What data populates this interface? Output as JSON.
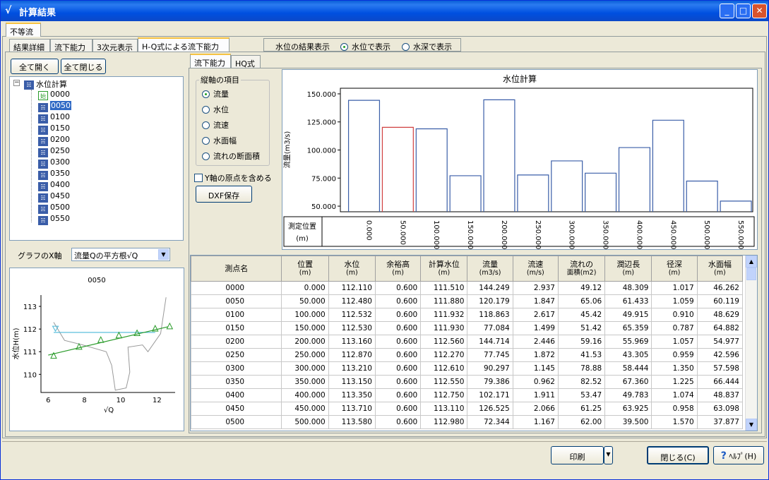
{
  "window": {
    "title": "計算結果"
  },
  "top_tab": "不等流",
  "sub_tabs": [
    "結果詳細",
    "流下能力",
    "3次元表示",
    "H-Q式による流下能力"
  ],
  "result_display": {
    "label": "水位の結果表示",
    "options": [
      "水位で表示",
      "水深で表示"
    ],
    "selected": "水位で表示"
  },
  "tree": {
    "buttons": [
      "全て開く",
      "全て閉じる"
    ],
    "root": "水位計算",
    "items": [
      "0000",
      "0050",
      "0100",
      "0150",
      "0200",
      "0250",
      "0300",
      "0350",
      "0400",
      "0450",
      "0500",
      "0550"
    ],
    "selected": "0050"
  },
  "graph_x": {
    "label": "グラフのX軸",
    "value": "流量Qの平方根√Q"
  },
  "small_chart": {
    "title": "0050",
    "ylabel": "水位H(m)",
    "xlabel": "√Q",
    "y_ticks": [
      "113",
      "112",
      "111",
      "110"
    ],
    "x_ticks": [
      "6",
      "8",
      "10",
      "12"
    ]
  },
  "right_tabs": [
    "流下能力",
    "HQ式"
  ],
  "axis_group": {
    "label": "縦軸の項目",
    "options": [
      "流量",
      "水位",
      "流速",
      "水面幅",
      "流れの断面積"
    ],
    "selected": "流量"
  },
  "y_origin_checkbox": "Y軸の原点を含める",
  "dxf_button": "DXF保存",
  "chart_data": {
    "type": "bar",
    "title": "水位計算",
    "ylabel": "流量(m3/s)",
    "xlabel": "測定位置(m)",
    "y_ticks": [
      "150.000",
      "125.000",
      "100.000",
      "75.000",
      "50.000"
    ],
    "ylim": [
      45,
      155
    ],
    "x_ticks": [
      "0.000",
      "50.000",
      "100.000",
      "150.000",
      "200.000",
      "250.000",
      "300.000",
      "350.000",
      "400.000",
      "450.000",
      "500.000",
      "550.000"
    ],
    "x": [
      0,
      50,
      100,
      150,
      200,
      250,
      300,
      350,
      400,
      450,
      500,
      550
    ],
    "values": [
      144.249,
      120.179,
      118.863,
      77.084,
      144.714,
      77.745,
      90.297,
      79.386,
      102.171,
      126.525,
      72.344,
      54.5
    ],
    "highlight_index": 1,
    "colors": {
      "bar": "#3a5ea8",
      "highlight": "#d04040"
    }
  },
  "table": {
    "headers": [
      [
        "測点名",
        ""
      ],
      [
        "位置",
        "(m)"
      ],
      [
        "水位",
        "(m)"
      ],
      [
        "余裕高",
        "(m)"
      ],
      [
        "計算水位",
        "(m)"
      ],
      [
        "流量",
        "(m3/s)"
      ],
      [
        "流速",
        "(m/s)"
      ],
      [
        "流れの",
        "面積(m2)"
      ],
      [
        "潤辺長",
        "(m)"
      ],
      [
        "径深",
        "(m)"
      ],
      [
        "水面幅",
        "(m)"
      ]
    ],
    "rows": [
      [
        "0000",
        "0.000",
        "112.110",
        "0.600",
        "111.510",
        "144.249",
        "2.937",
        "49.12",
        "48.309",
        "1.017",
        "46.262"
      ],
      [
        "0050",
        "50.000",
        "112.480",
        "0.600",
        "111.880",
        "120.179",
        "1.847",
        "65.06",
        "61.433",
        "1.059",
        "60.119"
      ],
      [
        "0100",
        "100.000",
        "112.532",
        "0.600",
        "111.932",
        "118.863",
        "2.617",
        "45.42",
        "49.915",
        "0.910",
        "48.629"
      ],
      [
        "0150",
        "150.000",
        "112.530",
        "0.600",
        "111.930",
        "77.084",
        "1.499",
        "51.42",
        "65.359",
        "0.787",
        "64.882"
      ],
      [
        "0200",
        "200.000",
        "113.160",
        "0.600",
        "112.560",
        "144.714",
        "2.446",
        "59.16",
        "55.969",
        "1.057",
        "54.977"
      ],
      [
        "0250",
        "250.000",
        "112.870",
        "0.600",
        "112.270",
        "77.745",
        "1.872",
        "41.53",
        "43.305",
        "0.959",
        "42.596"
      ],
      [
        "0300",
        "300.000",
        "113.210",
        "0.600",
        "112.610",
        "90.297",
        "1.145",
        "78.88",
        "58.444",
        "1.350",
        "57.598"
      ],
      [
        "0350",
        "350.000",
        "113.150",
        "0.600",
        "112.550",
        "79.386",
        "0.962",
        "82.52",
        "67.360",
        "1.225",
        "66.444"
      ],
      [
        "0400",
        "400.000",
        "113.350",
        "0.600",
        "112.750",
        "102.171",
        "1.911",
        "53.47",
        "49.783",
        "1.074",
        "48.837"
      ],
      [
        "0450",
        "450.000",
        "113.710",
        "0.600",
        "113.110",
        "126.525",
        "2.066",
        "61.25",
        "63.925",
        "0.958",
        "63.098"
      ],
      [
        "0500",
        "500.000",
        "113.580",
        "0.600",
        "112.980",
        "72.344",
        "1.167",
        "62.00",
        "39.500",
        "1.570",
        "37.877"
      ]
    ]
  },
  "footer": {
    "print": "印刷",
    "close": "閉じる(C)",
    "help": "ﾍﾙﾌﾟ(H)"
  }
}
